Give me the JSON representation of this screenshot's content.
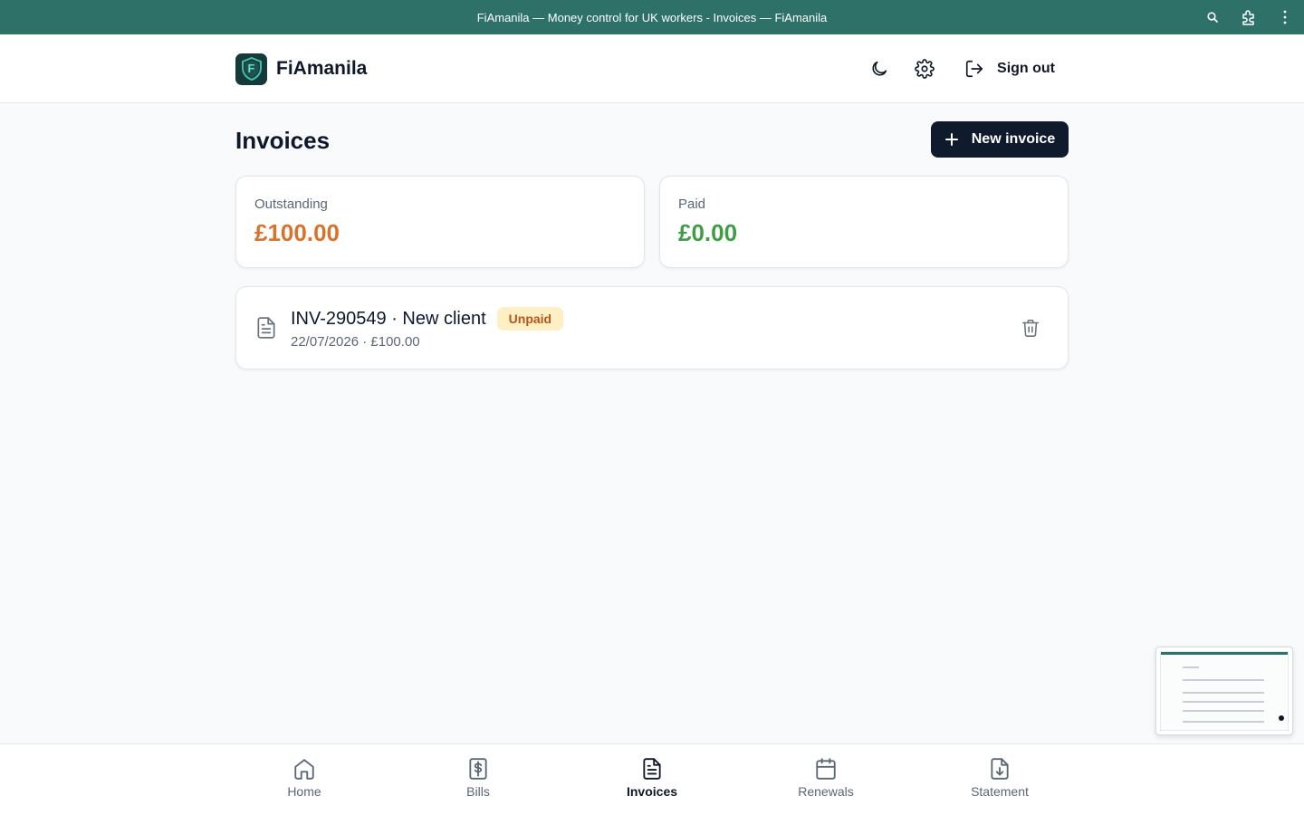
{
  "window": {
    "title": "FiAmanila — Money control for UK workers - Invoices — FiAmanila",
    "icons": [
      "zoom-icon",
      "extensions-icon",
      "kebab-menu-icon"
    ]
  },
  "header": {
    "brand_name": "FiAmanila",
    "logo_letter": "F",
    "sign_out_label": "Sign out"
  },
  "page": {
    "title": "Invoices",
    "new_invoice_label": "New invoice"
  },
  "stats": {
    "outstanding": {
      "label": "Outstanding",
      "value": "£100.00",
      "color": "#d9722b"
    },
    "paid": {
      "label": "Paid",
      "value": "£0.00",
      "color": "#3f9d46"
    }
  },
  "invoices": [
    {
      "title": "INV-290549 · New client",
      "status": "Unpaid",
      "subtitle": "22/07/2026 · £100.00"
    }
  ],
  "nav": {
    "items": [
      {
        "label": "Home",
        "icon": "home-icon",
        "active": false
      },
      {
        "label": "Bills",
        "icon": "bill-icon",
        "active": false
      },
      {
        "label": "Invoices",
        "icon": "document-icon",
        "active": true
      },
      {
        "label": "Renewals",
        "icon": "calendar-icon",
        "active": false
      },
      {
        "label": "Statement",
        "icon": "download-document-icon",
        "active": false
      }
    ]
  },
  "colors": {
    "titlebar": "#2e7168",
    "primary_button": "#0f1b2d",
    "badge_bg": "#fdf0c4",
    "badge_text": "#b5541b"
  }
}
